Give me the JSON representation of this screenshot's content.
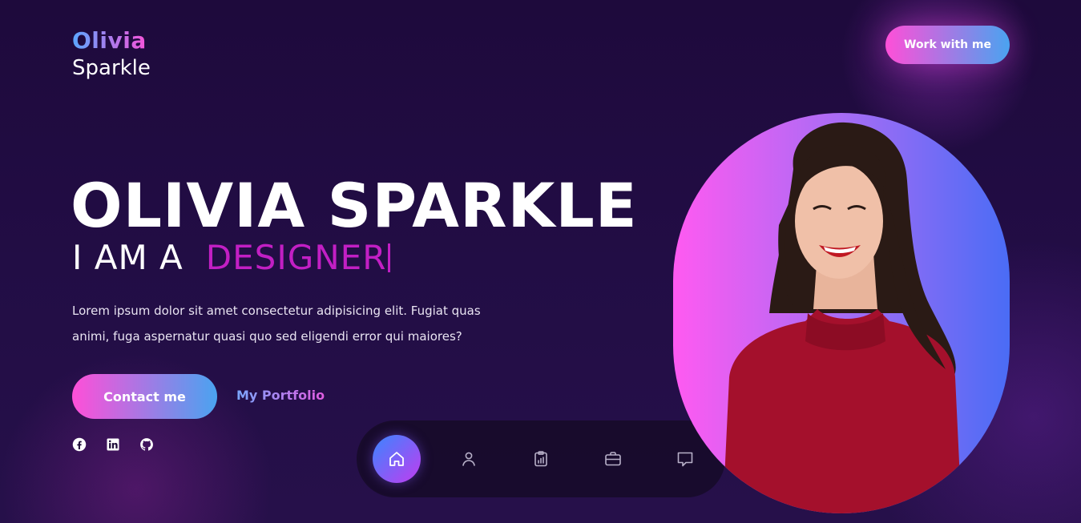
{
  "logo": {
    "first": "Olivia",
    "last": "Sparkle"
  },
  "header": {
    "cta_label": "Work with me"
  },
  "hero": {
    "name": "OLIVIA SPARKLE",
    "prefix": "I AM A",
    "role": "DESIGNER",
    "description": "Lorem ipsum dolor sit amet consectetur adipisicing elit. Fugiat quas animi, fuga aspernatur quasi quo sed eligendi error qui maiores?",
    "contact_label": "Contact me",
    "portfolio_label": "My Portfolio"
  },
  "socials": [
    {
      "icon": "facebook-icon"
    },
    {
      "icon": "linkedin-icon"
    },
    {
      "icon": "github-icon"
    }
  ],
  "dock": [
    {
      "icon": "home-icon",
      "active": true
    },
    {
      "icon": "user-icon",
      "active": false
    },
    {
      "icon": "clipboard-chart-icon",
      "active": false
    },
    {
      "icon": "briefcase-icon",
      "active": false
    },
    {
      "icon": "message-icon",
      "active": false
    }
  ],
  "colors": {
    "background": "#1d0b38",
    "accent_pink": "#ff4fd8",
    "accent_blue": "#4aa3f0",
    "role_text": "#c21fc4",
    "portrait_left": "#ff5af1",
    "portrait_right": "#4a6cf5"
  }
}
